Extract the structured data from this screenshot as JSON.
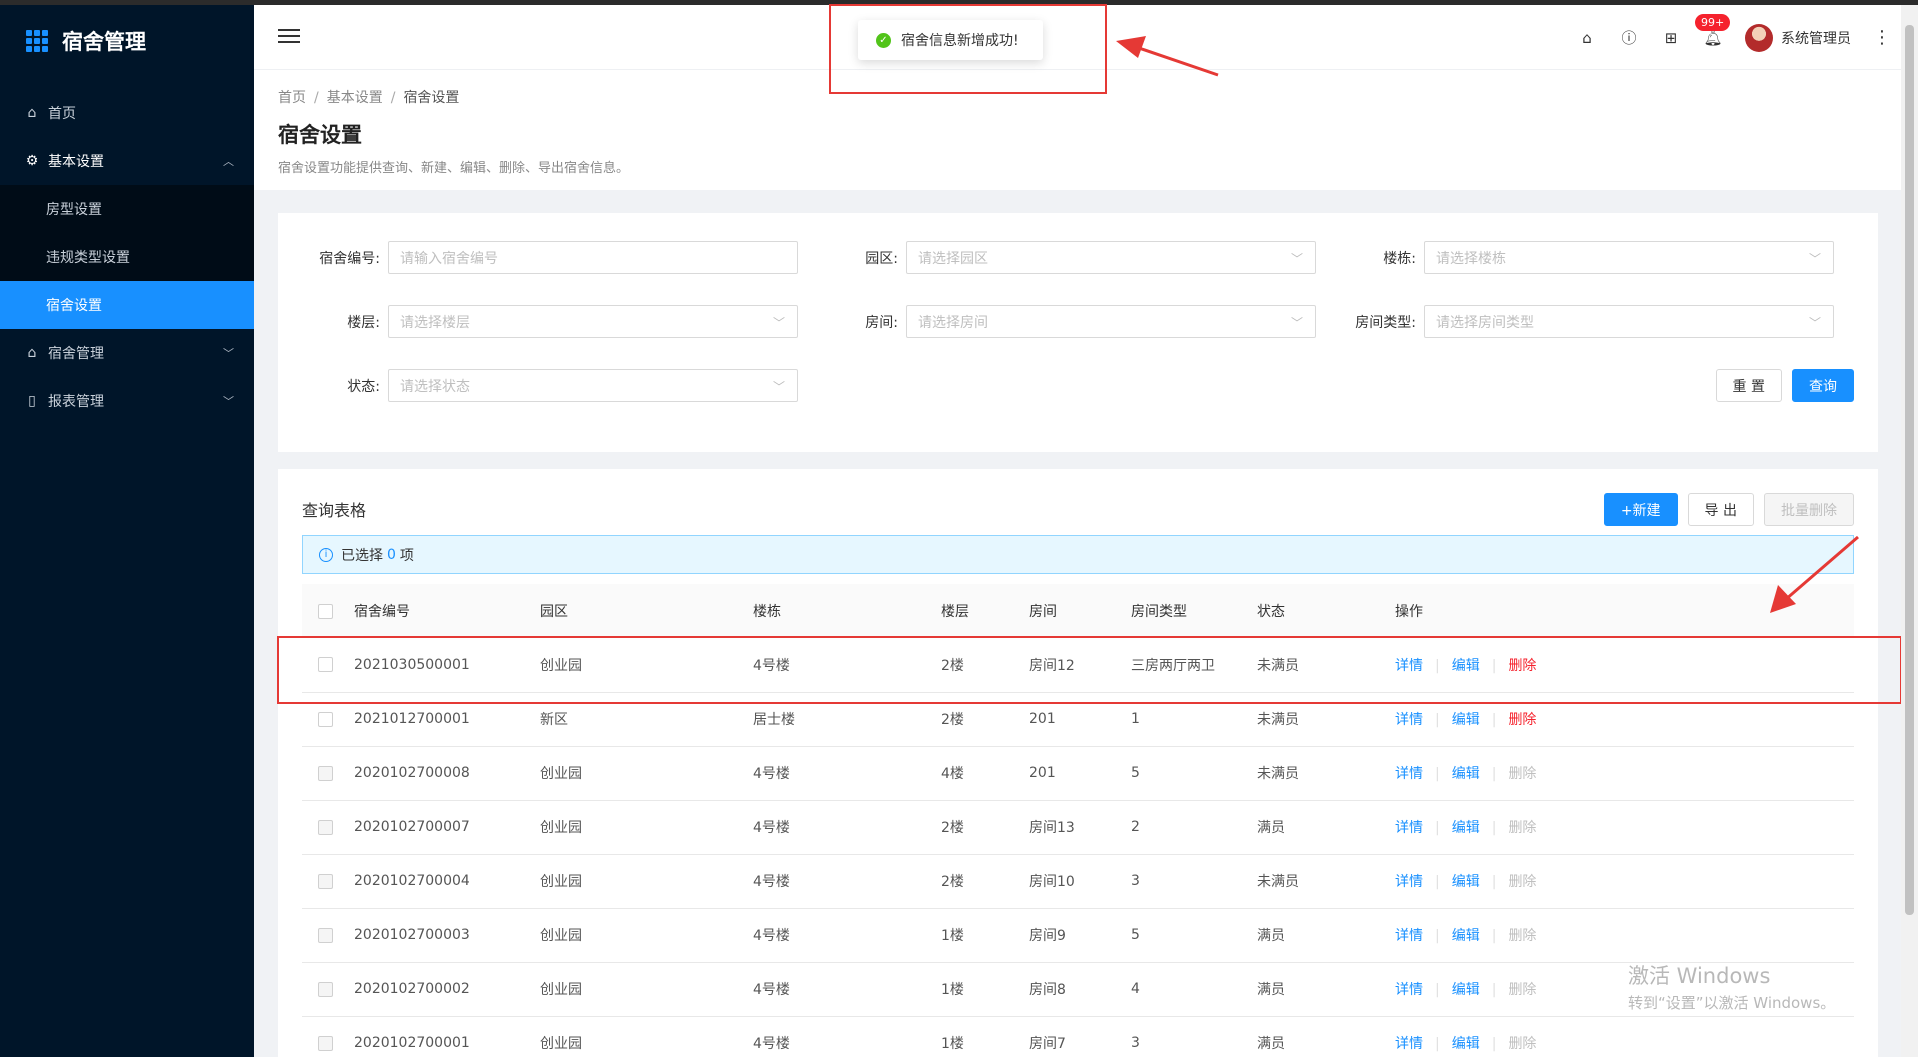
{
  "app": {
    "title": "宿舍管理"
  },
  "sidebar": {
    "items": [
      {
        "label": "首页",
        "icon": "home-icon"
      },
      {
        "label": "基本设置",
        "icon": "gear-icon",
        "open": true,
        "children": [
          {
            "label": "房型设置"
          },
          {
            "label": "违规类型设置"
          },
          {
            "label": "宿舍设置",
            "active": true
          }
        ]
      },
      {
        "label": "宿舍管理",
        "icon": "home-icon"
      },
      {
        "label": "报表管理",
        "icon": "book-icon"
      }
    ]
  },
  "header": {
    "badge": "99+",
    "user_name": "系统管理员"
  },
  "toast": {
    "message": "宿舍信息新增成功!"
  },
  "page": {
    "breadcrumb": [
      "首页",
      "基本设置",
      "宿舍设置"
    ],
    "title": "宿舍设置",
    "description": "宿舍设置功能提供查询、新建、编辑、删除、导出宿舍信息。"
  },
  "filters": {
    "dorm_no": {
      "label": "宿舍编号:",
      "placeholder": "请输入宿舍编号"
    },
    "park": {
      "label": "园区:",
      "placeholder": "请选择园区"
    },
    "building": {
      "label": "楼栋:",
      "placeholder": "请选择楼栋"
    },
    "floor": {
      "label": "楼层:",
      "placeholder": "请选择楼层"
    },
    "room": {
      "label": "房间:",
      "placeholder": "请选择房间"
    },
    "room_type": {
      "label": "房间类型:",
      "placeholder": "请选择房间类型"
    },
    "status": {
      "label": "状态:",
      "placeholder": "请选择状态"
    },
    "reset_label": "重 置",
    "search_label": "查询"
  },
  "table": {
    "title": "查询表格",
    "new_label": "+新建",
    "export_label": "导 出",
    "batch_delete_label": "批量删除",
    "selected_prefix": "已选择",
    "selected_count": "0",
    "selected_suffix": "项",
    "columns": [
      "宿舍编号",
      "园区",
      "楼栋",
      "楼层",
      "房间",
      "房间类型",
      "状态",
      "操作"
    ],
    "action_labels": {
      "detail": "详情",
      "edit": "编辑",
      "delete": "删除"
    },
    "rows": [
      {
        "no": "2021030500001",
        "park": "创业园",
        "building": "4号楼",
        "floor": "2楼",
        "room": "房间12",
        "room_type": "三房两厅两卫",
        "status": "未满员",
        "delete_enabled": true
      },
      {
        "no": "2021012700001",
        "park": "新区",
        "building": "居士楼",
        "floor": "2楼",
        "room": "201",
        "room_type": "1",
        "status": "未满员",
        "delete_enabled": true
      },
      {
        "no": "2020102700008",
        "park": "创业园",
        "building": "4号楼",
        "floor": "4楼",
        "room": "201",
        "room_type": "5",
        "status": "未满员",
        "delete_enabled": false
      },
      {
        "no": "2020102700007",
        "park": "创业园",
        "building": "4号楼",
        "floor": "2楼",
        "room": "房间13",
        "room_type": "2",
        "status": "满员",
        "delete_enabled": false
      },
      {
        "no": "2020102700004",
        "park": "创业园",
        "building": "4号楼",
        "floor": "2楼",
        "room": "房间10",
        "room_type": "3",
        "status": "未满员",
        "delete_enabled": false
      },
      {
        "no": "2020102700003",
        "park": "创业园",
        "building": "4号楼",
        "floor": "1楼",
        "room": "房间9",
        "room_type": "5",
        "status": "满员",
        "delete_enabled": false
      },
      {
        "no": "2020102700002",
        "park": "创业园",
        "building": "4号楼",
        "floor": "1楼",
        "room": "房间8",
        "room_type": "4",
        "status": "满员",
        "delete_enabled": false
      },
      {
        "no": "2020102700001",
        "park": "创业园",
        "building": "4号楼",
        "floor": "1楼",
        "room": "房间7",
        "room_type": "3",
        "status": "满员",
        "delete_enabled": false
      }
    ]
  },
  "watermark": {
    "line1": "激活 Windows",
    "line2": "转到“设置”以激活 Windows。"
  },
  "colors": {
    "sidebar_bg": "#001529",
    "accent": "#1890ff",
    "danger": "#f5222d",
    "success": "#52c41a",
    "annotation": "#e53935"
  }
}
